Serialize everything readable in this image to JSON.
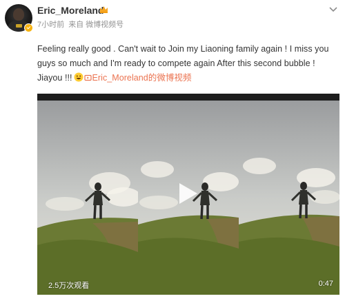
{
  "author": {
    "name": "Eric_Moreland",
    "badge_color": "#f6b312"
  },
  "meta": {
    "time": "7小时前",
    "source_prefix": "来自",
    "source": "微博视频号"
  },
  "post": {
    "text_main": "Feeling really good . Can't wait to Join my Liaoning family again ! I miss you guys so much and I'm ready to compete again After this second bubble ! Jiayou !!!",
    "emoji": "grinning-face-emoji",
    "video_link": "Eric_Moreland的微博视频",
    "link_color": "#eb7350"
  },
  "video": {
    "views": "2.5万次观看",
    "duration": "0:47",
    "play_icon": "play-icon"
  }
}
